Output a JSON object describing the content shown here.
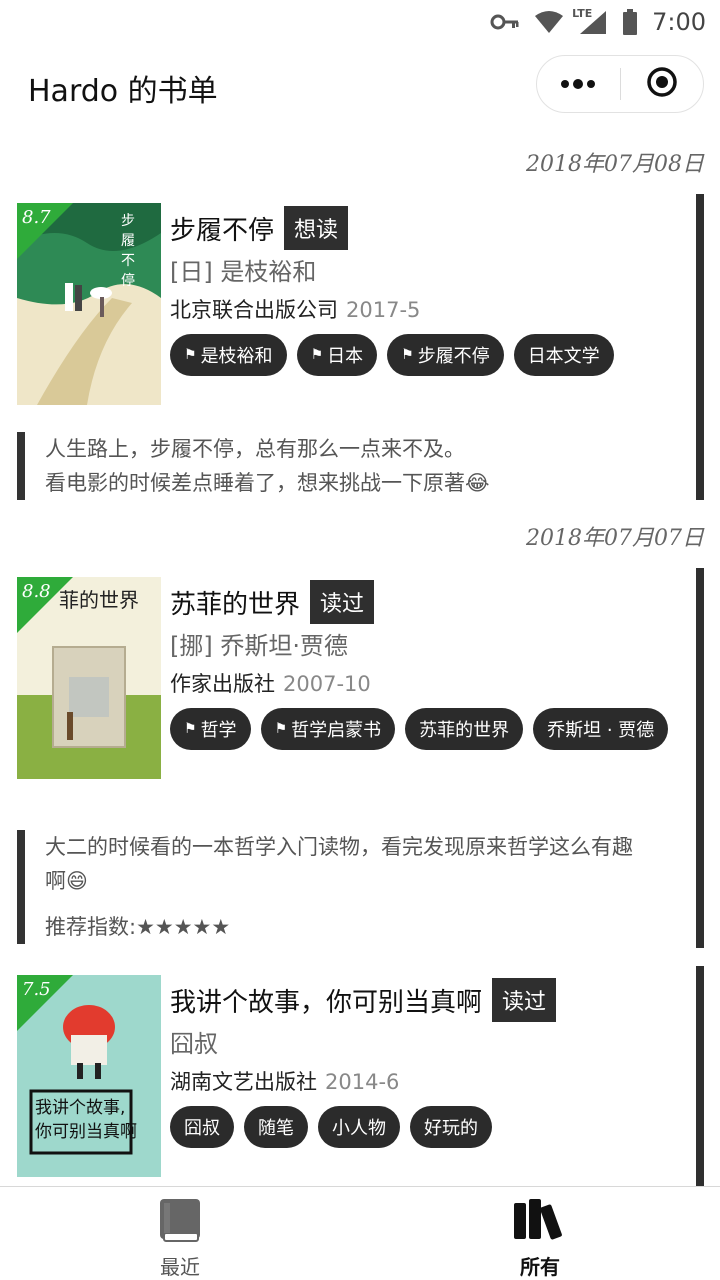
{
  "status_bar": {
    "network": "LTE",
    "time": "7:00"
  },
  "nav": {
    "title": "Hardo 的书单",
    "icons": [
      "more-icon",
      "target-icon"
    ]
  },
  "dates": [
    "2018年07月08日",
    "2018年07月07日"
  ],
  "books": [
    {
      "rating": "8.7",
      "title": "步履不停",
      "status": "想读",
      "author": "[日] 是枝裕和",
      "publisher": "北京联合出版公司",
      "pub_date": "2017-5",
      "tags": [
        {
          "label": "是枝裕和",
          "flag": true
        },
        {
          "label": "日本",
          "flag": true
        },
        {
          "label": "步履不停",
          "flag": true
        },
        {
          "label": "日本文学",
          "flag": false
        }
      ],
      "review_lines": [
        "人生路上，步履不停，总有那么一点来不及。",
        "看电影的时候差点睡着了，想来挑战一下原著😂"
      ]
    },
    {
      "rating": "8.8",
      "title": "苏菲的世界",
      "status": "读过",
      "author": "[挪] 乔斯坦·贾德",
      "publisher": "作家出版社",
      "pub_date": "2007-10",
      "tags": [
        {
          "label": "哲学",
          "flag": true
        },
        {
          "label": "哲学启蒙书",
          "flag": true
        },
        {
          "label": "苏菲的世界",
          "flag": false
        },
        {
          "label": "乔斯坦 · 贾德",
          "flag": false
        }
      ],
      "review_lines": [
        "大二的时候看的一本哲学入门读物，看完发现原来哲学这么有趣",
        "啊😄"
      ],
      "recommend_label": "推荐指数:",
      "recommend_stars": "★★★★★"
    },
    {
      "rating": "7.5",
      "title": "我讲个故事，你可别当真啊",
      "status": "读过",
      "author": "囧叔",
      "publisher": "湖南文艺出版社",
      "pub_date": "2014-6",
      "tags": [
        {
          "label": "囧叔",
          "flag": false
        },
        {
          "label": "随笔",
          "flag": false
        },
        {
          "label": "小人物",
          "flag": false
        },
        {
          "label": "好玩的",
          "flag": false
        }
      ]
    }
  ],
  "tabs": [
    {
      "label": "最近",
      "icon": "book-icon",
      "active": false
    },
    {
      "label": "所有",
      "icon": "books-icon",
      "active": true
    }
  ]
}
